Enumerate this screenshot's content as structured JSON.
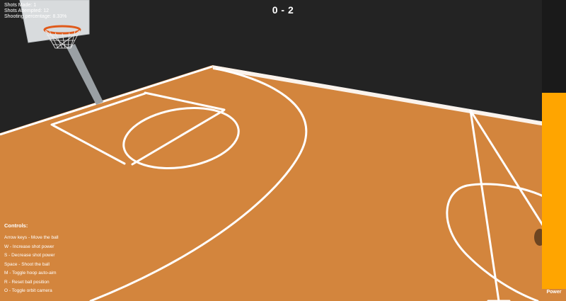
{
  "hud": {
    "shots_made": "Shots Made: 1",
    "shots_attempted": "Shots Attempted: 12",
    "shooting_percentage": "Shooting percentage: 8.33%"
  },
  "scoreboard": {
    "score": "0 - 2"
  },
  "controls": {
    "title": "Controls:",
    "items": [
      "Arrow keys - Move the ball",
      "W - Increase shot power",
      "S - Decrease shot power",
      "Space - Shoot the ball",
      "M - Toggle hoop auto-aim",
      "R - Reset ball position",
      "O - Toggle orbit camera"
    ]
  },
  "power_meter": {
    "label": "Power",
    "level": 0.68
  },
  "colors": {
    "court": "#d3853d",
    "court_lines": "#ffffff",
    "background": "#232323",
    "power_fill": "#ffa500"
  }
}
